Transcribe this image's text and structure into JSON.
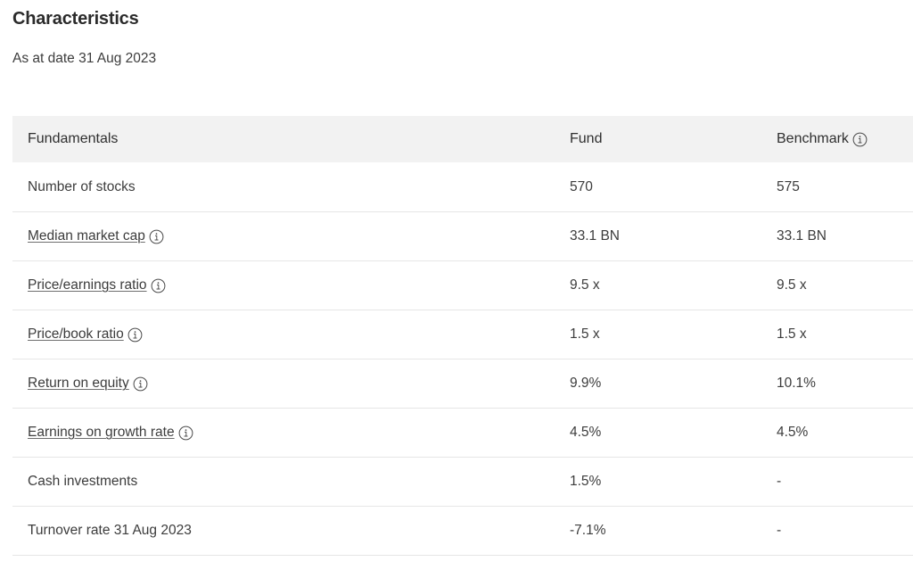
{
  "header": {
    "title": "Characteristics",
    "as_at_date": "As at date 31 Aug 2023"
  },
  "icons": {
    "info": "info-circle-icon"
  },
  "table": {
    "columns": {
      "label": "Fundamentals",
      "fund": "Fund",
      "benchmark": "Benchmark",
      "benchmark_has_info": true
    },
    "rows": [
      {
        "label": "Number of stocks",
        "linked": false,
        "has_info": false,
        "fund": "570",
        "benchmark": "575"
      },
      {
        "label": "Median market cap",
        "linked": true,
        "has_info": true,
        "fund": "33.1 BN",
        "benchmark": "33.1 BN"
      },
      {
        "label": "Price/earnings ratio",
        "linked": true,
        "has_info": true,
        "fund": "9.5 x",
        "benchmark": "9.5 x"
      },
      {
        "label": "Price/book ratio",
        "linked": true,
        "has_info": true,
        "fund": "1.5 x",
        "benchmark": "1.5 x"
      },
      {
        "label": "Return on equity",
        "linked": true,
        "has_info": true,
        "fund": "9.9%",
        "benchmark": "10.1%"
      },
      {
        "label": "Earnings on growth rate",
        "linked": true,
        "has_info": true,
        "fund": "4.5%",
        "benchmark": "4.5%"
      },
      {
        "label": "Cash investments",
        "linked": false,
        "has_info": false,
        "fund": "1.5%",
        "benchmark": "-"
      },
      {
        "label": "Turnover rate 31 Aug 2023",
        "linked": false,
        "has_info": false,
        "fund": "-7.1%",
        "benchmark": "-"
      }
    ]
  },
  "colors": {
    "text": "#3c3c3c",
    "title": "#2b2b2b",
    "header_band": "#f2f2f2",
    "divider": "#e6e6e6",
    "background": "#ffffff"
  }
}
